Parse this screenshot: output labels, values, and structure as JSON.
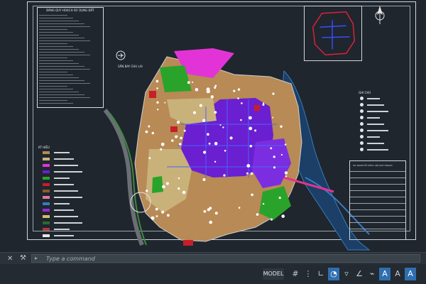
{
  "drawing": {
    "table_title": "BẢNG QUY HOẠCH SỬ DỤNG ĐẤT",
    "airport_label": "SÂN BAY CHU LAI",
    "legend_title": "KÝ HIỆU",
    "notes_title": "GHI CHÚ",
    "title_block_caption": "CƠ QUAN TỔ CHỨC LẬP QUY HOẠCH",
    "colors": {
      "magenta": "#e234d6",
      "purple": "#6a1fd0",
      "tan": "#b88a55",
      "beige": "#c9b27a",
      "green": "#2aa32a",
      "red": "#c81e2a",
      "water": "#2b5f9a",
      "road_blue": "#4d62ff"
    }
  },
  "command_line": {
    "placeholder": "Type a command",
    "close_icon": "close-icon",
    "settings_icon": "wrench-icon"
  },
  "status_bar": {
    "model_label": "MODEL",
    "icons": [
      "grid-icon",
      "snap-icon",
      "ortho-icon",
      "polar-icon",
      "osnap-icon",
      "otrack-icon",
      "lineweight-icon",
      "annotation-scale-icon",
      "annotate-icon",
      "workspace-icon"
    ]
  }
}
